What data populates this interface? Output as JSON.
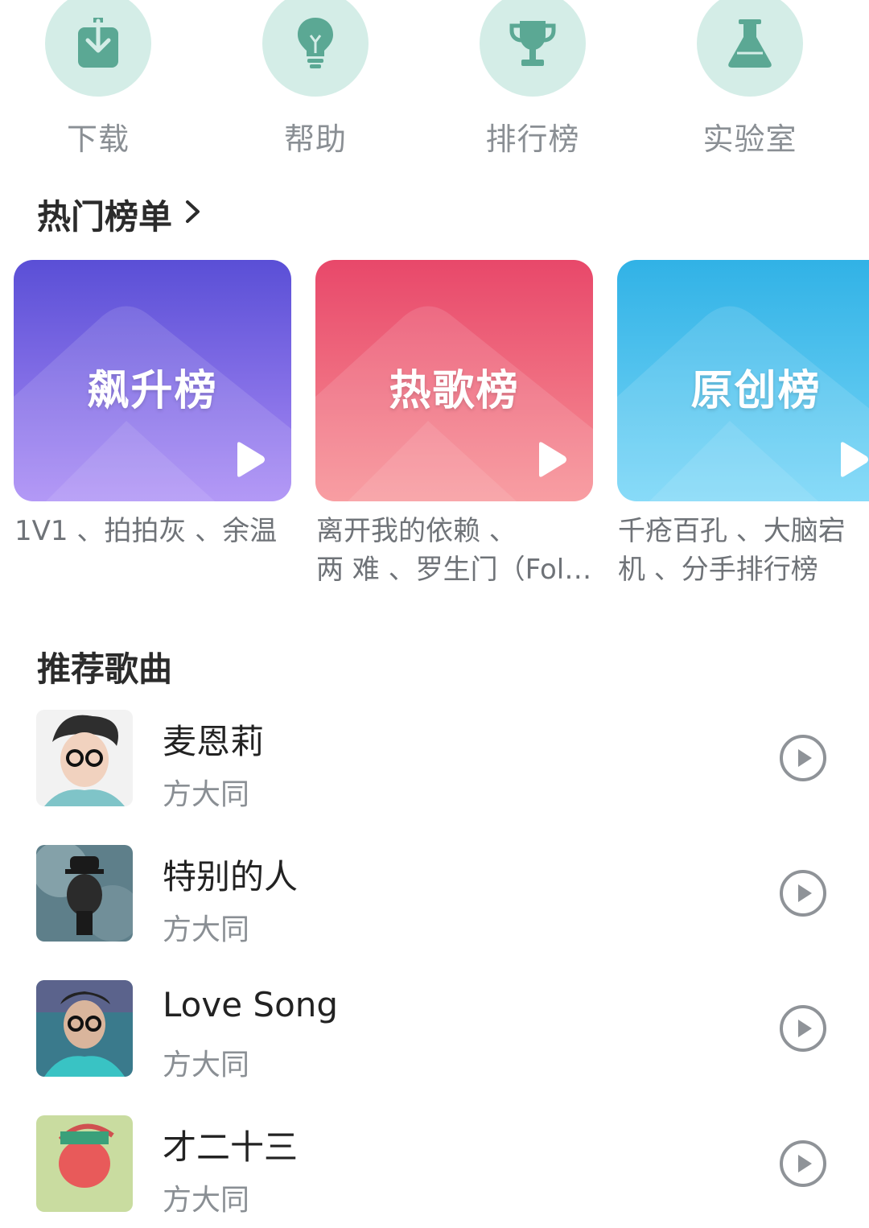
{
  "quick_actions": [
    {
      "label": "下载",
      "icon": "download-icon"
    },
    {
      "label": "帮助",
      "icon": "lightbulb-icon"
    },
    {
      "label": "排行榜",
      "icon": "trophy-icon"
    },
    {
      "label": "实验室",
      "icon": "flask-icon"
    }
  ],
  "hot_charts": {
    "title": "热门榜单",
    "cards": [
      {
        "title": "飙升榜",
        "desc_lines": [
          "1V1 、拍拍灰 、余温"
        ],
        "color_top": "#5a4fd6",
        "color_bottom": "#a98bf5"
      },
      {
        "title": "热歌榜",
        "desc_lines": [
          "离开我的依赖 、",
          "两 难 、罗生门（Follow）"
        ],
        "color_top": "#e8486a",
        "color_bottom": "#f79196"
      },
      {
        "title": "原创榜",
        "desc_lines": [
          "千疮百孔 、大脑宕",
          "机 、分手排行榜"
        ],
        "color_top": "#31b2e6",
        "color_bottom": "#78d6f7"
      }
    ]
  },
  "recommended": {
    "title": "推荐歌曲",
    "songs": [
      {
        "title": "麦恩莉",
        "artist": "方大同"
      },
      {
        "title": "特别的人",
        "artist": "方大同"
      },
      {
        "title": "Love Song",
        "artist": "方大同"
      },
      {
        "title": "才二十三",
        "artist": "方大同"
      }
    ]
  },
  "colors": {
    "accent": "#5ba894",
    "icon_circle": "#d4ede7",
    "text_secondary": "#8a8f94"
  }
}
